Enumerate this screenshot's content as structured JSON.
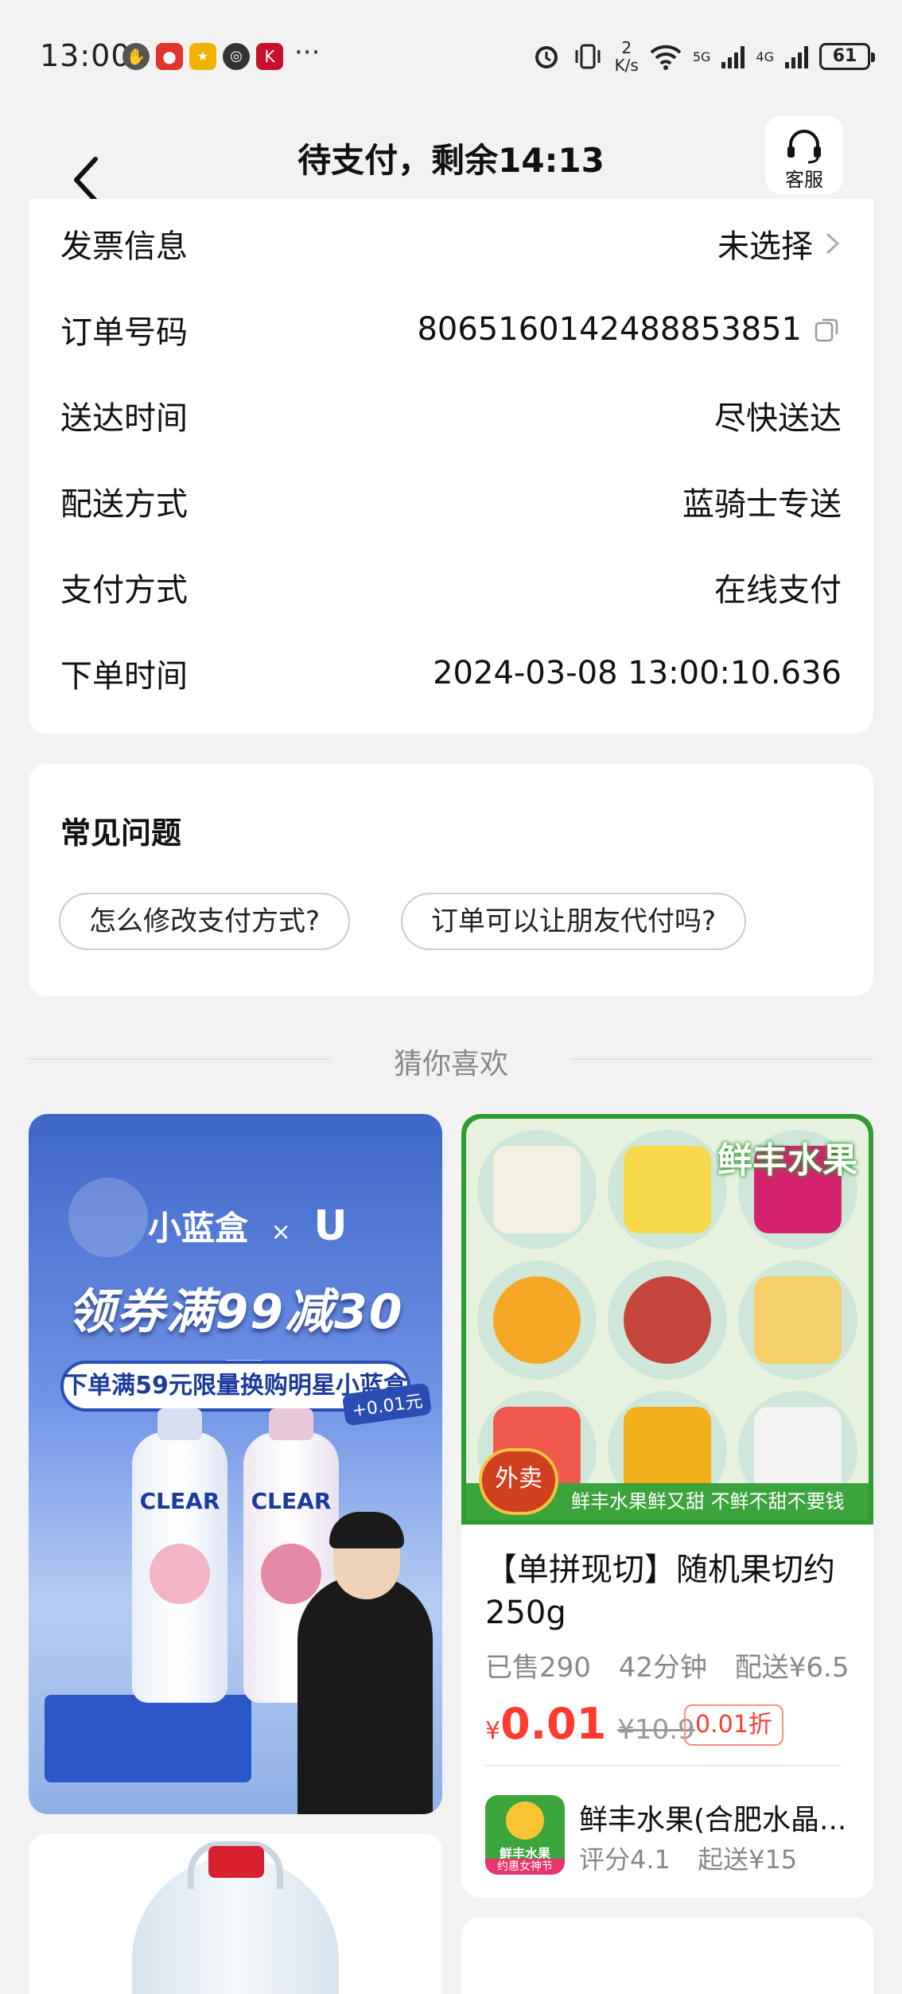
{
  "status_bar": {
    "time": "13:00",
    "net_speed_value": "2",
    "net_speed_unit": "K/s",
    "sim1": "5G",
    "sim2": "4G",
    "battery": "61",
    "more": "···"
  },
  "header": {
    "title": "待支付，剩余14:13",
    "service_label": "客服"
  },
  "order_info": {
    "rows": [
      {
        "label": "发票信息",
        "value": "未选择"
      },
      {
        "label": "订单号码",
        "value": "8065160142488853851"
      },
      {
        "label": "送达时间",
        "value": "尽快送达"
      },
      {
        "label": "配送方式",
        "value": "蓝骑士专送"
      },
      {
        "label": "支付方式",
        "value": "在线支付"
      },
      {
        "label": "下单时间",
        "value": "2024-03-08 13:00:10.636"
      }
    ]
  },
  "faq": {
    "title": "常见问题",
    "questions": [
      "怎么修改支付方式?",
      "订单可以让朋友代付吗?"
    ]
  },
  "recommend": {
    "title": "猜你喜欢"
  },
  "ad": {
    "brand": "小蓝盒",
    "cross": "×",
    "headline": "领券满99减30元",
    "pill": "下单满59元限量换购明星小蓝盒",
    "tag": "+0.01元",
    "bottle_brand": "CLEAR"
  },
  "product": {
    "image_brand": "鲜丰水果",
    "image_slogan": "鲜丰水果鲜又甜   不鲜不甜不要钱",
    "image_badge": "外卖",
    "name": "【单拼现切】随机果切约250g",
    "sold": "已售290",
    "time": "42分钟",
    "delivery": "配送¥6.5",
    "currency": "¥",
    "price": "0.01",
    "original_price": "¥10.9",
    "discount": "0.01折",
    "shop_logo_text": "鲜丰水果",
    "shop_logo_banner": "约惠女神节",
    "shop_name": "鲜丰水果(合肥水晶...",
    "rating": "评分4.1",
    "min_order": "起送¥15"
  },
  "colors": {
    "accent_red": "#ff3b30",
    "fruit_green": "#2f9b31",
    "ad_blue": "#3e66c8"
  }
}
